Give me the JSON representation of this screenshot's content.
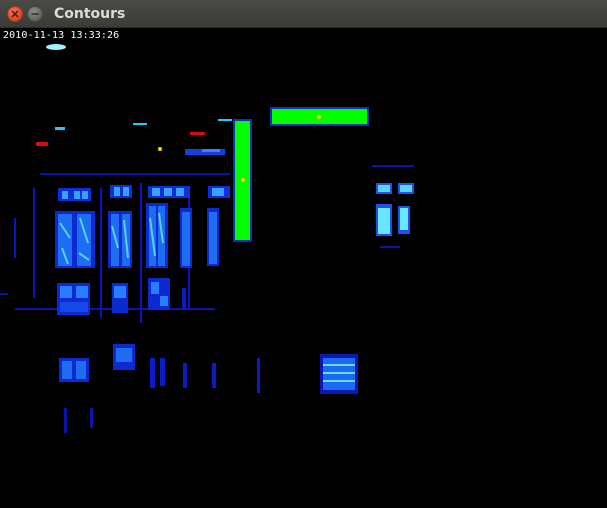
{
  "window": {
    "title": "Contours"
  },
  "overlay": {
    "timestamp": "2010-11-13 13:33:26"
  },
  "colors": {
    "titlebar": "#3c3b37",
    "close_button": "#e25a31",
    "minimize_button": "#6e6e6b",
    "contour_fill": "#00ff00",
    "contour_outline": "#1030c0",
    "centroid": "#ffd000",
    "background": "#000000"
  },
  "icons": {
    "close": "close-icon",
    "minimize": "minimize-icon"
  }
}
